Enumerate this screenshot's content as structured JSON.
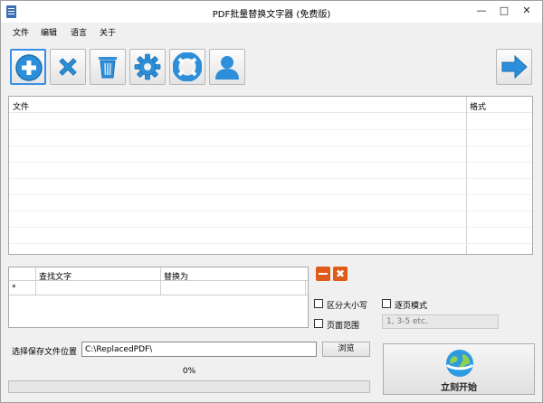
{
  "window": {
    "title": "PDF批量替换文字器 (免费版)"
  },
  "menu": [
    "文件",
    "编辑",
    "语言",
    "关于"
  ],
  "toolbar": {
    "buttons": [
      {
        "name": "add-file-button",
        "icon": "plus-circle-icon"
      },
      {
        "name": "remove-file-button",
        "icon": "x-icon"
      },
      {
        "name": "clear-list-button",
        "icon": "trash-icon"
      },
      {
        "name": "settings-button",
        "icon": "gear-icon"
      },
      {
        "name": "help-button",
        "icon": "lifebuoy-icon"
      },
      {
        "name": "account-button",
        "icon": "user-icon"
      }
    ],
    "next": {
      "name": "next-button",
      "icon": "arrow-right-icon"
    }
  },
  "file_list": {
    "columns": [
      "文件",
      "格式"
    ]
  },
  "replace_table": {
    "columns": [
      "查找文字",
      "替换为"
    ],
    "rows": [
      {
        "marker": "*",
        "find": "",
        "replace": ""
      }
    ]
  },
  "options": {
    "case_sensitive": "区分大小写",
    "page_by_page": "逐页模式",
    "page_range": "页面范围",
    "page_range_placeholder": "1, 3-5 etc."
  },
  "save": {
    "label": "选择保存文件位置",
    "path": "C:\\ReplacedPDF\\",
    "browse": "浏览"
  },
  "progress": {
    "text": "0%",
    "value": 0
  },
  "start": {
    "label": "立刻开始"
  }
}
